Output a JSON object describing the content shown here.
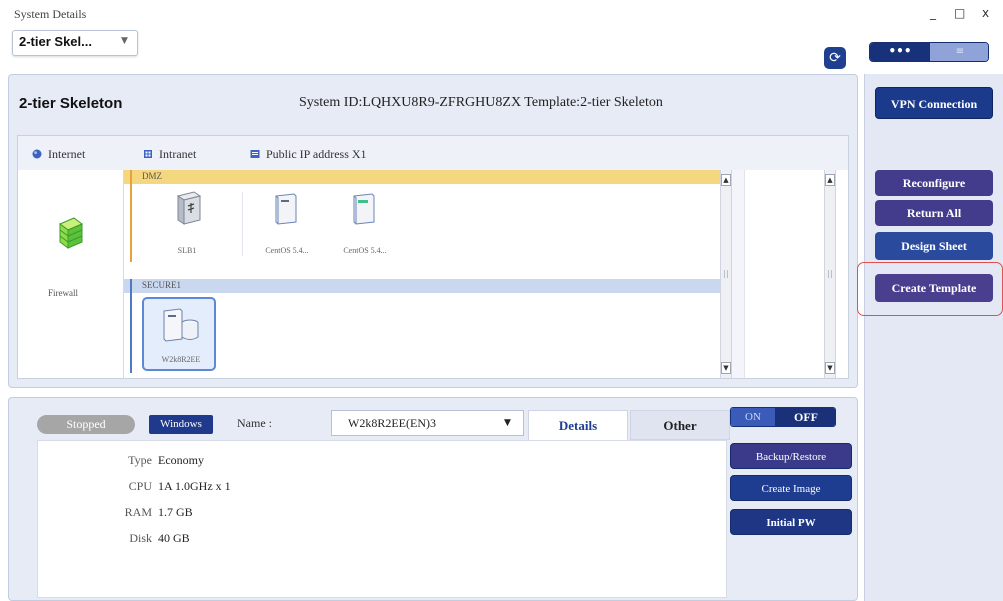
{
  "window": {
    "title": "System Details",
    "controls": [
      "_",
      "□",
      "x"
    ]
  },
  "header": {
    "system_select": "2-tier Skel...",
    "view_toggle": [
      "•••",
      "≡"
    ]
  },
  "system": {
    "name": "2-tier Skeleton",
    "info": "System ID:LQHXU8R9-ZFRGHU8ZX  Template:2-tier Skeleton"
  },
  "network": {
    "tabs": [
      {
        "label": "Internet",
        "icon": "globe-icon"
      },
      {
        "label": "Intranet",
        "icon": "building-icon"
      },
      {
        "label": "Public IP address X1",
        "icon": "ip-icon"
      }
    ],
    "firewall_label": "Firewall",
    "dmz": {
      "label": "DMZ",
      "nodes": [
        "SLB1",
        "CentOS 5.4...",
        "CentOS 5.4..."
      ]
    },
    "secure": {
      "label": "SECURE1",
      "nodes": [
        "W2k8R2EE"
      ]
    }
  },
  "sidebar": {
    "vpn": "VPN Connection",
    "reconfigure": "Reconfigure",
    "return_all": "Return All",
    "design_sheet": "Design Sheet",
    "create_template": "Create Template"
  },
  "server": {
    "status": "Stopped",
    "os": "Windows",
    "name_label": "Name :",
    "name_value": "W2k8R2EE(EN)3",
    "tabs": {
      "details": "Details",
      "other": "Other"
    },
    "specs": [
      {
        "key": "Type",
        "value": "Economy"
      },
      {
        "key": "CPU",
        "value": "1A 1.0GHz x 1"
      },
      {
        "key": "RAM",
        "value": "1.7 GB"
      },
      {
        "key": "Disk",
        "value": "40 GB"
      }
    ],
    "power": {
      "on": "ON",
      "off": "OFF"
    },
    "actions": {
      "backup": "Backup/Restore",
      "create_image": "Create Image",
      "initial_pw": "Initial PW"
    }
  }
}
